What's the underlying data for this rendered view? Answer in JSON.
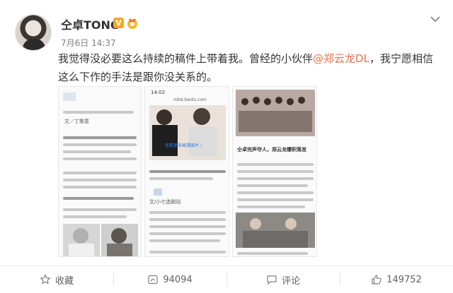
{
  "post": {
    "username": "仝卓TONG",
    "verified_badge": "V",
    "timestamp": "7月6日 14:37",
    "text_before_mention": "我觉得没必要这么持续的稿件上带着我。曾经的小伙伴",
    "mention": "@郑云龙DL",
    "text_after_mention": "，我宁愿相信这么下作的手法是跟你没关系的。"
  },
  "images": {
    "img1": {
      "label_row1": "文／丁歌意"
    },
    "img2": {
      "status_time": "14:02",
      "url": "mbd.baidu.com",
      "overlay": "查看更多高清图片 ›",
      "caption": "文/小七追剧站"
    },
    "img3": {
      "title": "仝卓完声夺人，郑云龙爆积落发"
    }
  },
  "actions": {
    "favorite": {
      "label": "收藏"
    },
    "repost": {
      "count": "94094"
    },
    "comment": {
      "label": "评论"
    },
    "like": {
      "count": "149752"
    }
  },
  "colors": {
    "mention": "#eb7350",
    "badge": "#f5a623"
  }
}
